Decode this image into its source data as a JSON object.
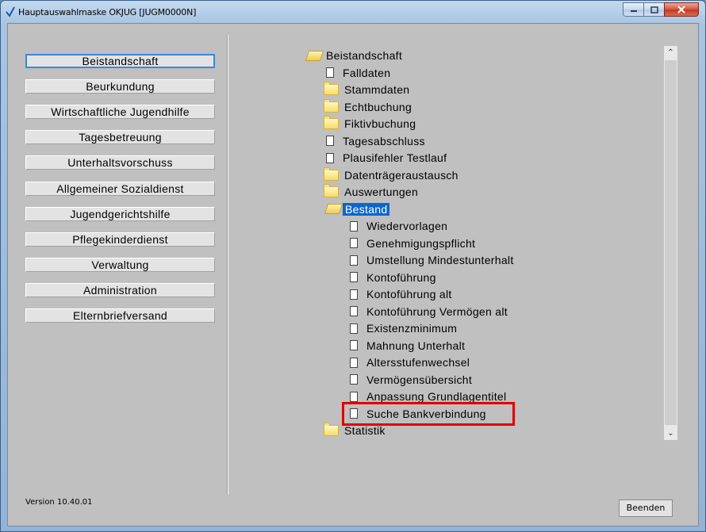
{
  "window": {
    "title": "Hauptauswahlmaske OKJUG [JUGM0000N]"
  },
  "nav": [
    {
      "label": "Beistandschaft",
      "active": true
    },
    {
      "label": "Beurkundung"
    },
    {
      "label": "Wirtschaftliche Jugendhilfe"
    },
    {
      "label": "Tagesbetreuung"
    },
    {
      "label": "Unterhaltsvorschuss"
    },
    {
      "label": "Allgemeiner Sozialdienst"
    },
    {
      "label": "Jugendgerichtshilfe"
    },
    {
      "label": "Pflegekinderdienst"
    },
    {
      "label": "Verwaltung"
    },
    {
      "label": "Administration"
    },
    {
      "label": "Elternbriefversand"
    }
  ],
  "tree": [
    {
      "label": "Beistandschaft",
      "icon": "open-folder-icon",
      "level": 0
    },
    {
      "label": "Falldaten",
      "icon": "document-icon",
      "level": 1
    },
    {
      "label": "Stammdaten",
      "icon": "folder-icon",
      "level": 1
    },
    {
      "label": "Echtbuchung",
      "icon": "folder-icon",
      "level": 1
    },
    {
      "label": "Fiktivbuchung",
      "icon": "folder-icon",
      "level": 1
    },
    {
      "label": "Tagesabschluss",
      "icon": "document-icon",
      "level": 1
    },
    {
      "label": "Plausifehler Testlauf",
      "icon": "document-icon",
      "level": 1
    },
    {
      "label": "Datenträgeraustausch",
      "icon": "folder-icon",
      "level": 1
    },
    {
      "label": "Auswertungen",
      "icon": "folder-icon",
      "level": 1
    },
    {
      "label": "Bestand",
      "icon": "open-folder-icon",
      "level": 1,
      "selected": true
    },
    {
      "label": "Wiedervorlagen",
      "icon": "document-icon",
      "level": 2
    },
    {
      "label": "Genehmigungspflicht",
      "icon": "document-icon",
      "level": 2
    },
    {
      "label": "Umstellung Mindestunterhalt",
      "icon": "document-icon",
      "level": 2
    },
    {
      "label": "Kontoführung",
      "icon": "document-icon",
      "level": 2
    },
    {
      "label": "Kontoführung alt",
      "icon": "document-icon",
      "level": 2
    },
    {
      "label": "Kontoführung Vermögen alt",
      "icon": "document-icon",
      "level": 2
    },
    {
      "label": "Existenzminimum",
      "icon": "document-icon",
      "level": 2
    },
    {
      "label": "Mahnung Unterhalt",
      "icon": "document-icon",
      "level": 2
    },
    {
      "label": "Altersstufenwechsel",
      "icon": "document-icon",
      "level": 2
    },
    {
      "label": "Vermögensübersicht",
      "icon": "document-icon",
      "level": 2
    },
    {
      "label": "Anpassung Grundlagentitel",
      "icon": "document-icon",
      "level": 2
    },
    {
      "label": "Suche Bankverbindung",
      "icon": "document-icon",
      "level": 2,
      "highlighted": true
    },
    {
      "label": "Statistik",
      "icon": "folder-icon",
      "level": 1
    }
  ],
  "footer": {
    "version": "Version 10.40.01",
    "close_label": "Beenden"
  },
  "colors": {
    "selection": "#0a66cc",
    "highlight_box": "#e00000",
    "background": "#c0c0c0"
  }
}
